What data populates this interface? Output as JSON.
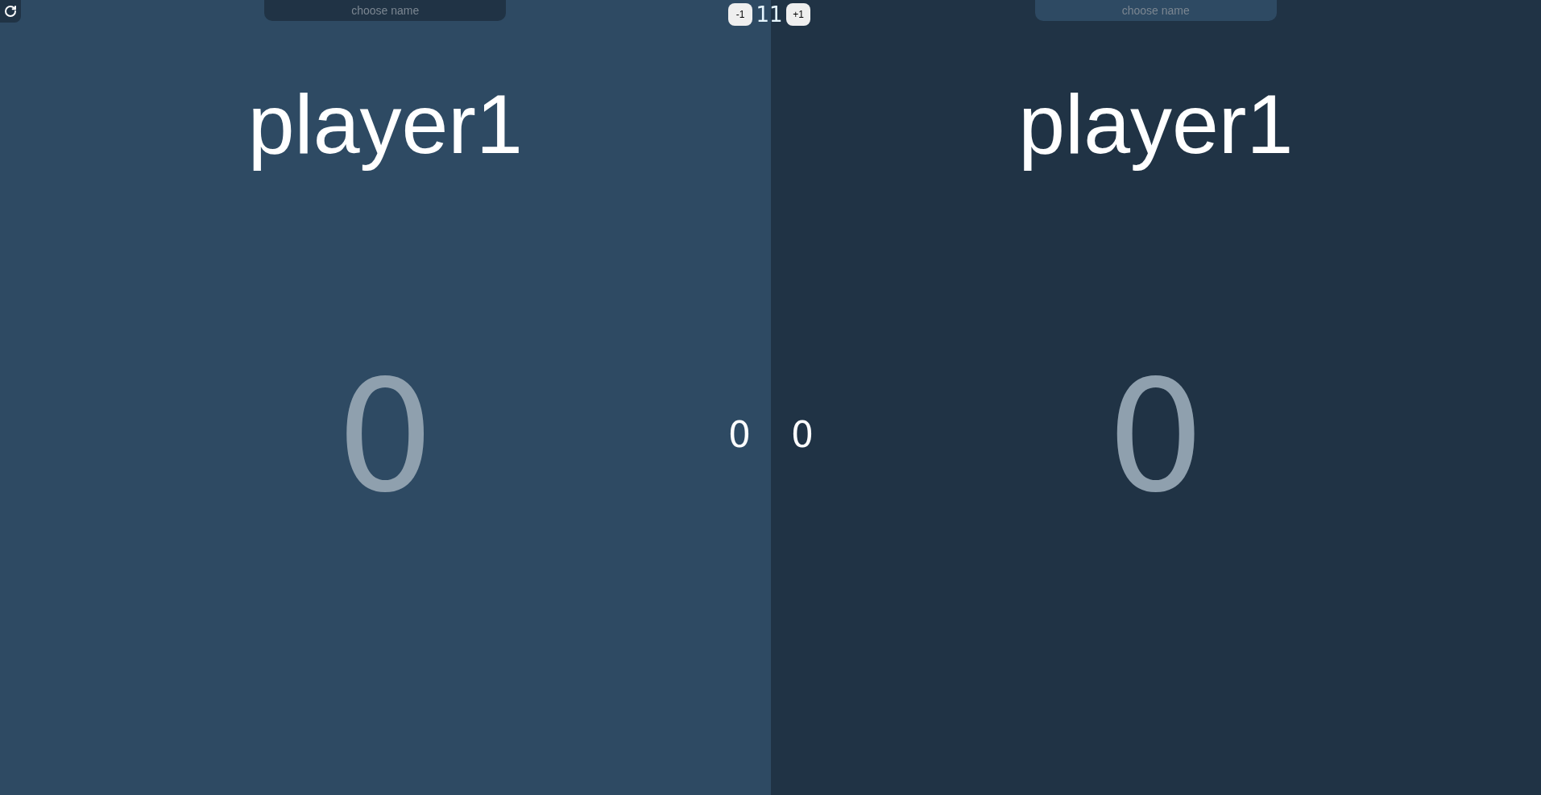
{
  "target": {
    "decrement": "-1",
    "value": "11",
    "increment": "+1"
  },
  "players": [
    {
      "placeholder": "choose name",
      "name": "player1",
      "score": "0",
      "games": "0"
    },
    {
      "placeholder": "choose name",
      "name": "player1",
      "score": "0",
      "games": "0"
    }
  ]
}
